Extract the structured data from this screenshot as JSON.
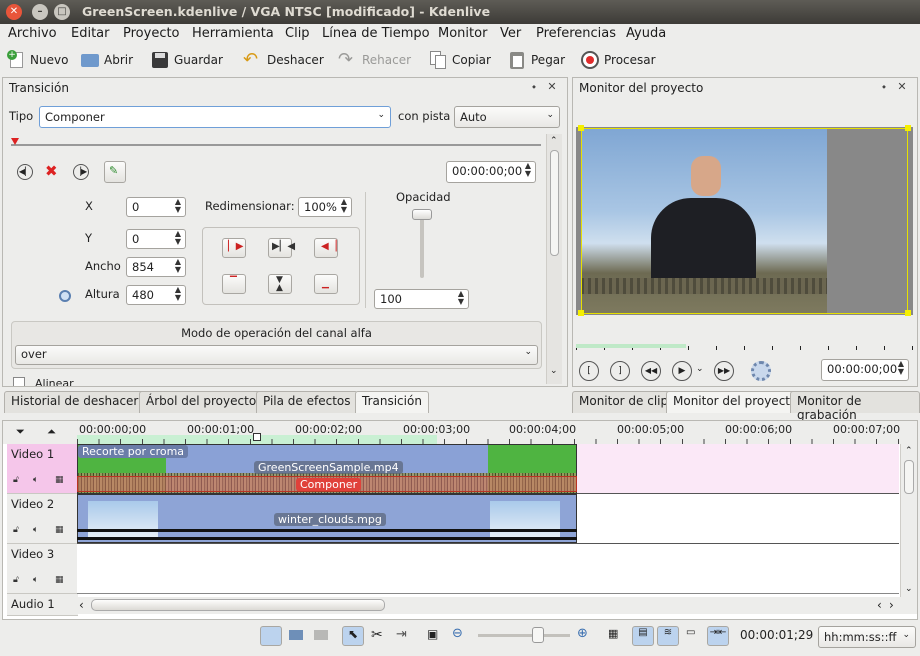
{
  "window": {
    "title": "GreenScreen.kdenlive / VGA NTSC [modificado] - Kdenlive"
  },
  "menu": [
    "Archivo",
    "Editar",
    "Proyecto",
    "Herramienta",
    "Clip",
    "Línea de Tiempo",
    "Monitor",
    "Ver",
    "Preferencias",
    "Ayuda"
  ],
  "toolbar": {
    "new": "Nuevo",
    "open": "Abrir",
    "save": "Guardar",
    "undo": "Deshacer",
    "redo": "Rehacer",
    "copy": "Copiar",
    "paste": "Pegar",
    "render": "Procesar"
  },
  "transition": {
    "title": "Transición",
    "type_label": "Tipo",
    "type_value": "Componer",
    "track_label": "con pista",
    "track_value": "Auto",
    "timecode": "00:00:00;00",
    "x_label": "X",
    "x": "0",
    "y_label": "Y",
    "y": "0",
    "width_label": "Ancho",
    "width": "854",
    "height_label": "Altura",
    "height": "480",
    "resize_label": "Redimensionar:",
    "resize": "100%",
    "opacity_label": "Opacidad",
    "opacity": "100",
    "alpha_title": "Modo de operación del canal alfa",
    "alpha_value": "over",
    "align_label": "Alinear"
  },
  "left_tabs": [
    "Historial de deshacer",
    "Árbol del proyecto",
    "Pila de efectos",
    "Transición"
  ],
  "monitor": {
    "title": "Monitor del proyecto",
    "timecode": "00:00:00;00"
  },
  "right_tabs": [
    "Monitor de clip",
    "Monitor del proyecto",
    "Monitor de grabación"
  ],
  "ruler": [
    "00:00:00;00",
    "00:00:01;00",
    "00:00:02;00",
    "00:00:03;00",
    "00:00:04;00",
    "00:00:05;00",
    "00:00:06;00",
    "00:00:07;00"
  ],
  "tracks": [
    {
      "name": "Video 1",
      "clip": "GreenScreenSample.mp4",
      "effect": "Recorte por croma",
      "transition": "Componer"
    },
    {
      "name": "Video 2",
      "clip": "winter_clouds.mpg"
    },
    {
      "name": "Video 3"
    },
    {
      "name": "Audio 1"
    }
  ],
  "status": {
    "timecode": "00:00:01;29",
    "format": "hh:mm:ss::ff"
  },
  "colors": {
    "accent": "#e0413a",
    "track1": "#f5c6ea",
    "video_clip": "#8aa1d6",
    "green_zone": "#c9f0d3"
  }
}
